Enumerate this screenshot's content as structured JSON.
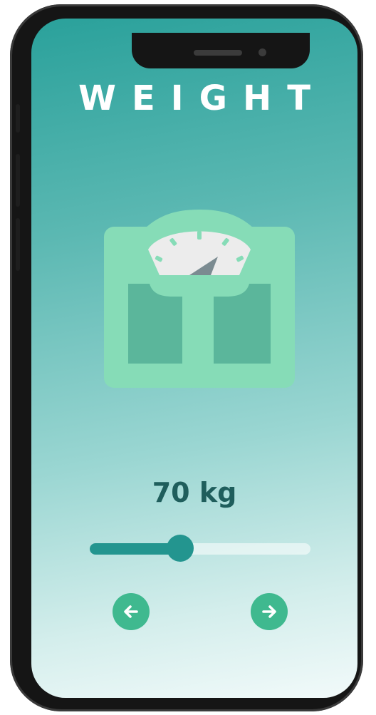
{
  "screen": {
    "title": "WEIGHT",
    "illustration_icon": "bathroom-scale-icon"
  },
  "weight": {
    "value_label": "70 kg",
    "slider_fraction": 0.41
  },
  "navigation": {
    "prev_icon": "arrow-left-icon",
    "next_icon": "arrow-right-icon"
  },
  "colors": {
    "gradient_top": "#2aa19b",
    "gradient_bottom": "#f2fafa",
    "accent": "#23958f",
    "nav_button": "#3fb98f",
    "value_text": "#1f5e5c",
    "scale_body": "#86dcb7",
    "scale_pads": "#5bb69b"
  }
}
